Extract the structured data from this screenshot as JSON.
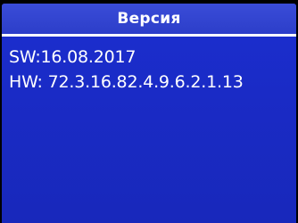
{
  "screen": {
    "title": "Версия",
    "software_version": "SW:16.08.2017",
    "hardware_version": "HW: 72.3.16.82.4.9.6.2.1.13"
  },
  "colors": {
    "background": "#1a2bc6",
    "title_bar": "#2c3ec9",
    "text": "#ffffff"
  }
}
